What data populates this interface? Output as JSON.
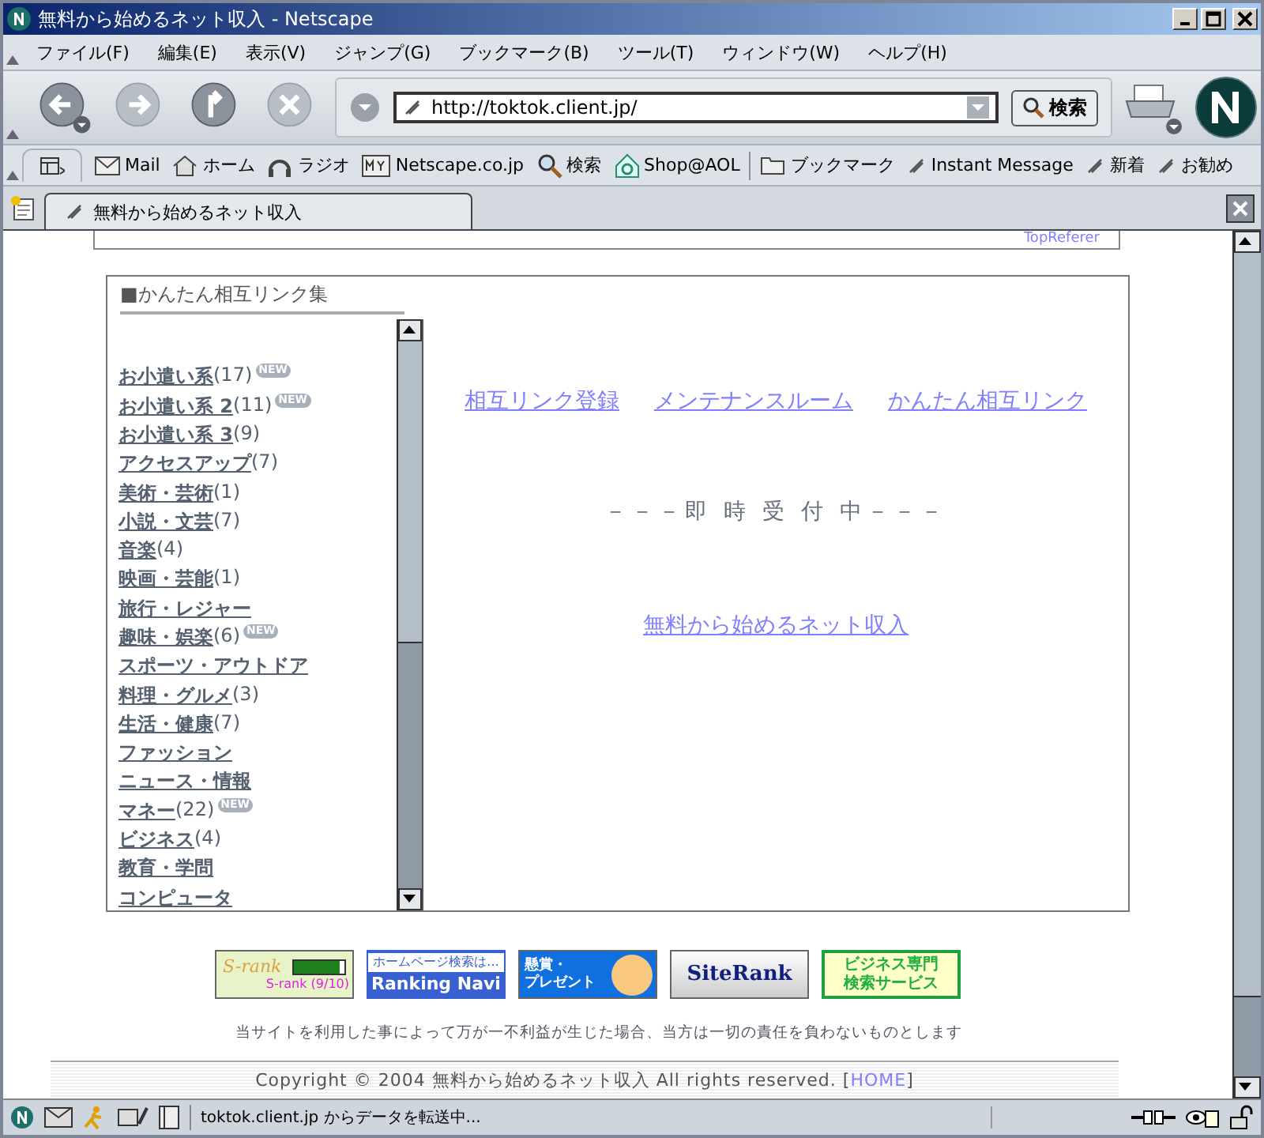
{
  "window": {
    "title": "無料から始めるネット収入 - Netscape"
  },
  "menu": [
    "ファイル(F)",
    "編集(E)",
    "表示(V)",
    "ジャンプ(G)",
    "ブックマーク(B)",
    "ツール(T)",
    "ウィンドウ(W)",
    "ヘルプ(H)"
  ],
  "address": {
    "value": "http://toktok.client.jp/"
  },
  "search_button": "検索",
  "bookmarks": [
    {
      "kind": "mail",
      "label": "Mail"
    },
    {
      "kind": "home",
      "label": "ホーム"
    },
    {
      "kind": "radio",
      "label": "ラジオ"
    },
    {
      "kind": "my",
      "label": "Netscape.co.jp"
    },
    {
      "kind": "search",
      "label": "検索"
    },
    {
      "kind": "shop",
      "label": "Shop@AOL"
    },
    {
      "kind": "folder",
      "label": "ブックマーク"
    },
    {
      "kind": "link",
      "label": "Instant Message"
    },
    {
      "kind": "link",
      "label": "新着"
    },
    {
      "kind": "link",
      "label": "お勧め"
    }
  ],
  "tab": {
    "title": "無料から始めるネット収入"
  },
  "top_box": {
    "text": "TopReferer"
  },
  "section": {
    "title": "■かんたん相互リンク集",
    "categories": [
      {
        "name": "お小遣い系",
        "count": "(17)",
        "badge": "NEW"
      },
      {
        "name": "お小遣い系 2",
        "count": "(11)",
        "badge": "NEW"
      },
      {
        "name": "お小遣い系 3",
        "count": "(9)"
      },
      {
        "name": "アクセスアップ",
        "count": "(7)"
      },
      {
        "name": "美術・芸術",
        "count": "(1)"
      },
      {
        "name": "小説・文芸",
        "count": "(7)"
      },
      {
        "name": "音楽",
        "count": "(4)"
      },
      {
        "name": "映画・芸能",
        "count": "(1)"
      },
      {
        "name": "旅行・レジャー"
      },
      {
        "name": "趣味・娯楽",
        "count": "(6)",
        "badge": "NEW"
      },
      {
        "name": "スポーツ・アウトドア"
      },
      {
        "name": "料理・グルメ",
        "count": "(3)"
      },
      {
        "name": "生活・健康",
        "count": "(7)"
      },
      {
        "name": "ファッション"
      },
      {
        "name": "ニュース・情報"
      },
      {
        "name": "マネー",
        "count": "(22)",
        "badge": "NEW"
      },
      {
        "name": "ビジネス",
        "count": "(4)"
      },
      {
        "name": "教育・学問"
      },
      {
        "name": "コンピュータ"
      }
    ],
    "links": [
      "相互リンク登録",
      "メンテナンスルーム",
      "かんたん相互リンク"
    ],
    "notice": "－－－即 時 受 付 中－－－",
    "home_link": "無料から始めるネット収入"
  },
  "banners": [
    {
      "kind": "srank",
      "lines": [
        "S-rank",
        "S-rank (9/10)"
      ]
    },
    {
      "kind": "navi",
      "lines": [
        "ホームページ検索は...",
        "Ranking Navi"
      ]
    },
    {
      "kind": "prize",
      "lines": [
        "懸賞・",
        "プレゼント"
      ]
    },
    {
      "kind": "siterank",
      "lines": [
        "SiteRank"
      ]
    },
    {
      "kind": "business",
      "lines": [
        "ビジネス専門",
        "検索サービス"
      ]
    }
  ],
  "disclaimer": "当サイトを利用した事によって万が一不利益が生じた場合、当方は一切の責任を負わないものとします",
  "footer": {
    "copyright": "Copyright © 2004 無料から始めるネット収入 All rights reserved. [",
    "home": "HOME",
    "close": "]"
  },
  "status_bar": {
    "text": "toktok.client.jp からデータを転送中..."
  }
}
